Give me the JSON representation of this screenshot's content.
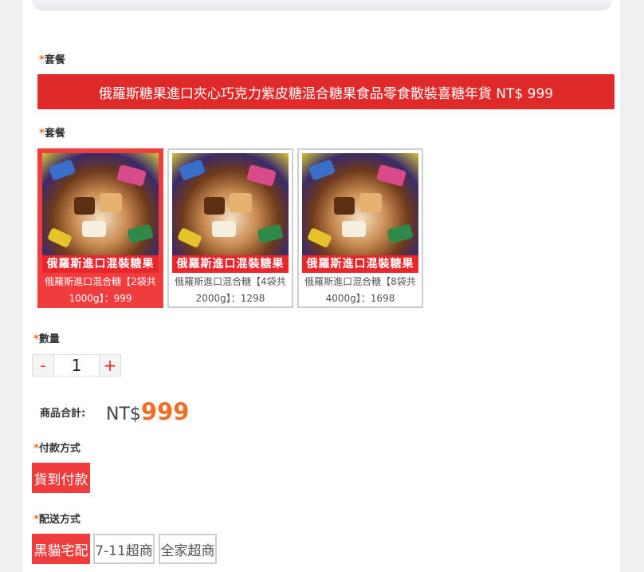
{
  "package_label_1": "套餐",
  "package_banner": "俄羅斯糖果進口夾心巧克力紫皮糖混合糖果食品零食散裝喜糖年貨 NT$ 999",
  "package_label_2": "套餐",
  "options": [
    {
      "caption": "俄羅斯進口混裝糖果",
      "line1": "俄羅斯進口混合糖【2袋共",
      "line2": "1000g】：999",
      "selected": true
    },
    {
      "caption": "俄羅斯進口混裝糖果",
      "line1": "俄羅斯進口混合糖【4袋共",
      "line2": "2000g】：1298",
      "selected": false
    },
    {
      "caption": "俄羅斯進口混裝糖果",
      "line1": "俄羅斯進口混合糖【8袋共",
      "line2": "4000g】：1698",
      "selected": false
    }
  ],
  "quantity": {
    "label": "數量",
    "minus": "-",
    "value": "1",
    "plus": "+"
  },
  "total": {
    "label": "商品合計:",
    "currency": "NT$",
    "amount": "999"
  },
  "payment": {
    "label": "付款方式",
    "options": [
      "貨到付款"
    ]
  },
  "shipping": {
    "label": "配送方式",
    "options": [
      "黑貓宅配",
      "7-11超商",
      "全家超商"
    ]
  },
  "required_mark": "*",
  "colors": {
    "accent": "#e02a2a",
    "price": "#f26d21"
  }
}
